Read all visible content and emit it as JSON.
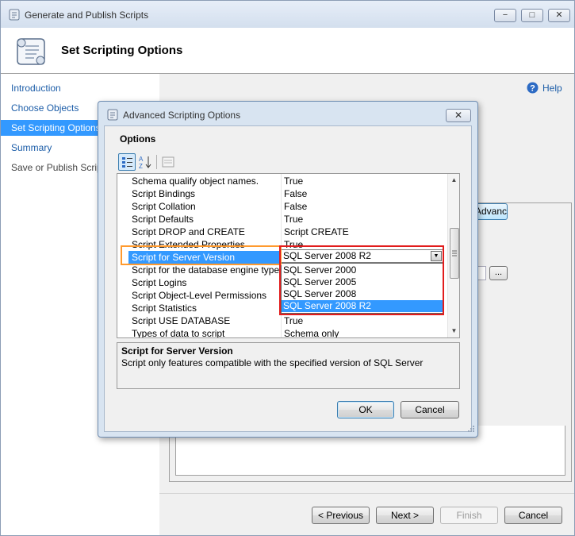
{
  "window": {
    "title": "Generate and Publish Scripts",
    "controls": {
      "minimize": "−",
      "maximize": "□",
      "close": "✕"
    }
  },
  "header": {
    "title": "Set Scripting Options",
    "icon": "scroll-icon"
  },
  "nav": {
    "items": [
      {
        "label": "Introduction",
        "state": "link"
      },
      {
        "label": "Choose Objects",
        "state": "link"
      },
      {
        "label": "Set Scripting Options",
        "state": "selected"
      },
      {
        "label": "Summary",
        "state": "link"
      },
      {
        "label": "Save or Publish Scripts",
        "state": "disabled"
      }
    ]
  },
  "help": {
    "label": "Help",
    "icon": "help-icon"
  },
  "background": {
    "advanced_label": "Advanced",
    "browse_label": "..."
  },
  "footer": {
    "previous_label": "< Previous",
    "next_label": "Next >",
    "finish_label": "Finish",
    "cancel_label": "Cancel"
  },
  "dialog": {
    "title": "Advanced Scripting Options",
    "close_label": "✕",
    "options_heading": "Options",
    "toolbar": [
      "categorized-icon",
      "alphabetical-sort-icon",
      "property-pages-icon"
    ],
    "grid": {
      "rows": [
        {
          "name": "Schema qualify object names.",
          "value": "True"
        },
        {
          "name": "Script Bindings",
          "value": "False"
        },
        {
          "name": "Script Collation",
          "value": "False"
        },
        {
          "name": "Script Defaults",
          "value": "True"
        },
        {
          "name": "Script DROP and CREATE",
          "value": "Script CREATE"
        },
        {
          "name": "Script Extended Properties",
          "value": "True"
        },
        {
          "name": "Script for Server Version",
          "value": "SQL Server 2008 R2",
          "selected": true
        },
        {
          "name": "Script for the database engine type",
          "value": ""
        },
        {
          "name": "Script Logins",
          "value": ""
        },
        {
          "name": "Script Object-Level Permissions",
          "value": ""
        },
        {
          "name": "Script Statistics",
          "value": ""
        },
        {
          "name": "Script USE DATABASE",
          "value": "True"
        },
        {
          "name": "Types of data to script",
          "value": "Schema only"
        }
      ],
      "dropdown": {
        "selected": "SQL Server 2008 R2",
        "options": [
          "SQL Server 2000",
          "SQL Server 2005",
          "SQL Server 2008",
          "SQL Server 2008 R2"
        ]
      }
    },
    "description": {
      "title": "Script for Server Version",
      "text": "Script only features compatible with the specified version of SQL Server"
    },
    "ok_label": "OK",
    "cancel_label": "Cancel"
  },
  "highlight_colors": {
    "property": "#ff9a2e",
    "dropdown": "#e21c1c"
  }
}
